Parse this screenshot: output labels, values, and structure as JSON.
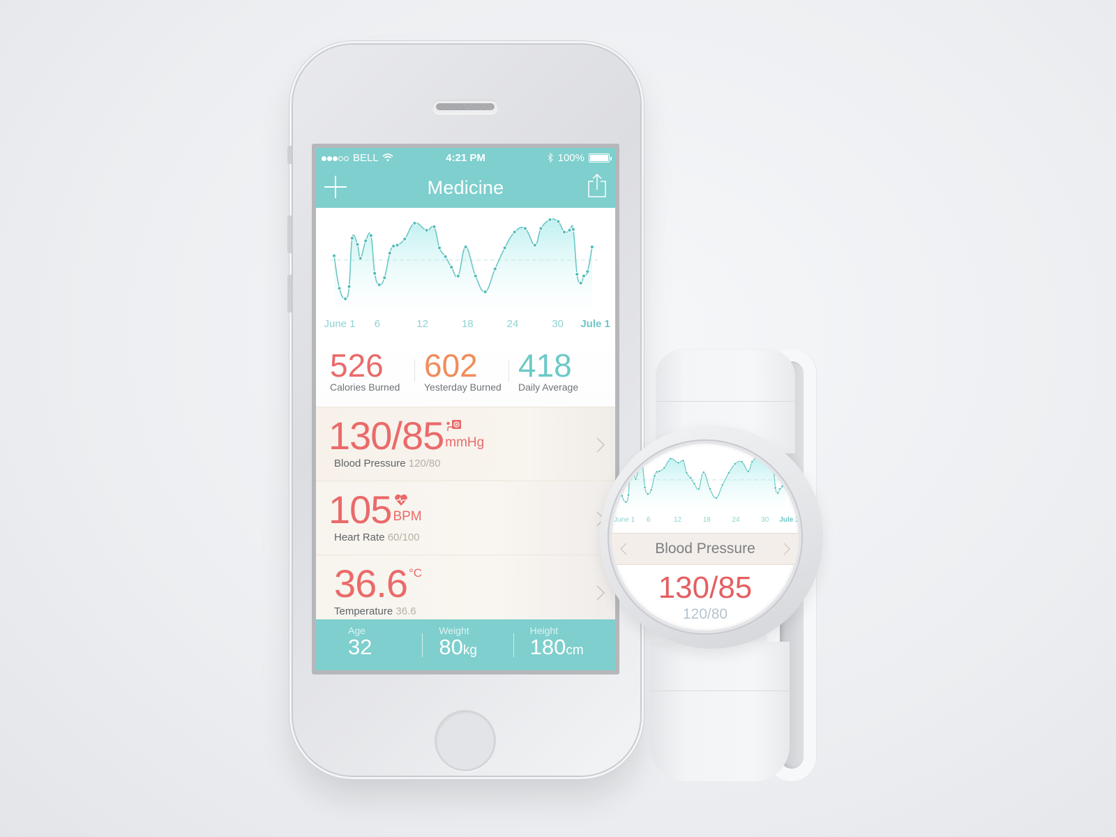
{
  "colors": {
    "accent": "#7ecfcd",
    "red": "#ea6a6a",
    "orange": "#f08c5a",
    "teal": "#6ccac7",
    "background": "#eceef1"
  },
  "phone": {
    "status_bar": {
      "signal_bars_filled": 3,
      "signal_bars_total": 5,
      "carrier": "BELL",
      "wifi_icon": "wifi-icon",
      "time": "4:21 PM",
      "bluetooth_icon": "bluetooth-icon",
      "battery": "100%",
      "battery_level": 1.0
    },
    "nav": {
      "title": "Medicine",
      "left_icon": "plus-icon",
      "right_icon": "share-icon"
    },
    "stats": [
      {
        "value": "526",
        "label": "Calories Burned",
        "color": "#ea6a6a"
      },
      {
        "value": "602",
        "label": "Yesterday Burned",
        "color": "#f08c5a"
      },
      {
        "value": "418",
        "label": "Daily Average",
        "color": "#6ccac7"
      }
    ],
    "rows": [
      {
        "value": "130/85",
        "unit": "mmHg",
        "icon": "blood-pressure-cuff-icon",
        "label": "Blood Pressure",
        "reference": "120/80"
      },
      {
        "value": "105",
        "unit": "BPM",
        "icon": "heart-pulse-icon",
        "label": "Heart Rate",
        "reference": "60/100"
      },
      {
        "value": "36.6",
        "unit": "°C",
        "icon": "",
        "label": "Temperature",
        "reference": "36.6"
      }
    ],
    "footer": [
      {
        "label": "Age",
        "value": "32",
        "unit": ""
      },
      {
        "label": "Weight",
        "value": "80",
        "unit": "kg"
      },
      {
        "label": "Height",
        "value": "180",
        "unit": "cm"
      }
    ]
  },
  "watch": {
    "title": "Blood Pressure",
    "value": "130/85",
    "reference": "120/80",
    "prev_icon": "chevron-left-icon",
    "next_icon": "chevron-right-icon"
  },
  "chart_data": {
    "type": "area",
    "title": "",
    "xlabel": "",
    "ylabel": "",
    "x_tick_labels": [
      "June 1",
      "6",
      "12",
      "18",
      "24",
      "30",
      "Jule 1"
    ],
    "x_tick_positions": [
      1,
      6,
      12,
      18,
      24,
      30,
      35
    ],
    "xlim": [
      1,
      35.5
    ],
    "ylim": [
      0,
      100
    ],
    "reference_line": 50,
    "grid": false,
    "legend": "none",
    "series": [
      {
        "name": "activity",
        "x": [
          1,
          1.7,
          2.5,
          3,
          3.4,
          4.1,
          4.5,
          5.2,
          5.9,
          6.4,
          7.0,
          7.7,
          8.4,
          8.9,
          9.4,
          10.4,
          11.7,
          13.3,
          14.3,
          15.0,
          15.8,
          16.6,
          17.5,
          18.5,
          19.8,
          21.1,
          22.4,
          23.7,
          25.0,
          26.4,
          27.7,
          28.5,
          29.7,
          30.8,
          31.6,
          32.3,
          32.8,
          33.3,
          33.8,
          34.2,
          34.7,
          35.3
        ],
        "y": [
          55,
          18,
          6,
          20,
          75,
          68,
          52,
          72,
          78,
          35,
          22,
          30,
          58,
          66,
          67,
          74,
          92,
          84,
          88,
          64,
          54,
          42,
          32,
          65,
          32,
          14,
          40,
          64,
          82,
          86,
          67,
          86,
          96,
          94,
          82,
          84,
          85,
          34,
          24,
          32,
          37,
          65
        ]
      }
    ]
  }
}
